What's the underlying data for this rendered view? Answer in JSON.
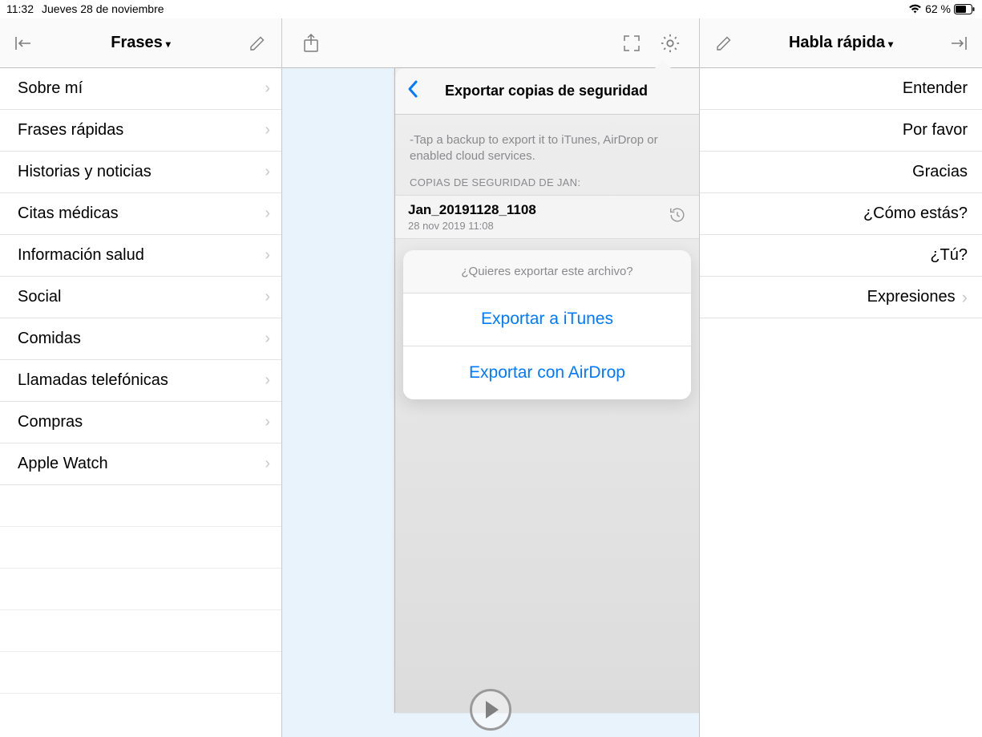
{
  "status": {
    "time": "11:32",
    "date": "Jueves 28 de noviembre",
    "battery": "62 %"
  },
  "left": {
    "title": "Frases",
    "items": [
      "Sobre mí",
      "Frases rápidas",
      "Historias y noticias",
      "Citas médicas",
      "Información salud",
      "Social",
      "Comidas",
      "Llamadas telefónicas",
      "Compras",
      "Apple Watch"
    ]
  },
  "right": {
    "title": "Habla rápida",
    "items": [
      "Entender",
      "Por favor",
      "Gracias",
      "¿Cómo estás?",
      "¿Tú?"
    ],
    "expresiones": "Expresiones"
  },
  "popover": {
    "title": "Exportar copias de seguridad",
    "hint": "-Tap a backup to export it to iTunes, AirDrop or enabled cloud services.",
    "section": "COPIAS DE SEGURIDAD DE JAN:",
    "backup_name": "Jan_20191128_1108",
    "backup_date": "28 nov 2019 11:08",
    "sheet_msg": "¿Quieres exportar este archivo?",
    "btn_itunes": "Exportar a iTunes",
    "btn_airdrop": "Exportar con AirDrop"
  }
}
